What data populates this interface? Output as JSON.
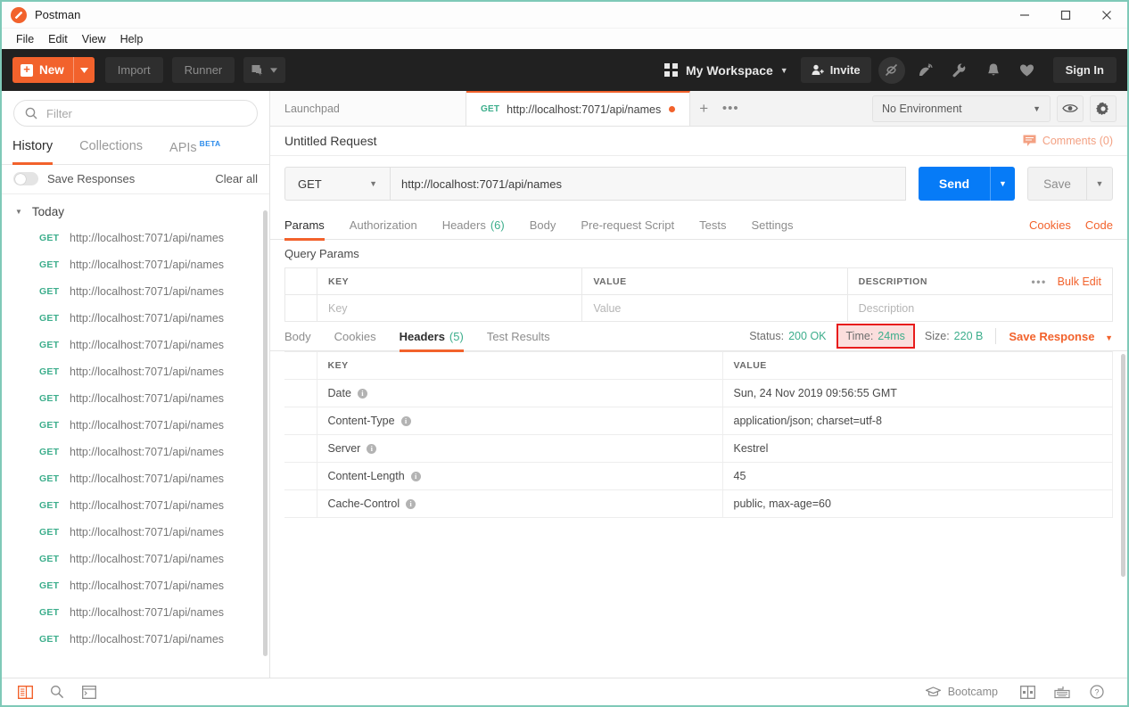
{
  "window": {
    "app_title": "Postman",
    "logo_icon": "postman-logo-icon",
    "minimize": "—",
    "maximize": "☐",
    "close": "✕"
  },
  "menubar": {
    "items": [
      "File",
      "Edit",
      "View",
      "Help"
    ]
  },
  "toolbar": {
    "new_label": "New",
    "new_plus": "+",
    "import_label": "Import",
    "runner_label": "Runner",
    "workspace_label": "My Workspace",
    "invite_label": "Invite",
    "sign_in_label": "Sign In",
    "icons": [
      "sync-off-icon",
      "satellite-dish-icon",
      "wrench-icon",
      "bell-icon",
      "heart-icon"
    ]
  },
  "sidebar": {
    "filter_placeholder": "Filter",
    "tabs": [
      {
        "label": "History",
        "active": true
      },
      {
        "label": "Collections",
        "active": false
      },
      {
        "label": "APIs",
        "badge": "BETA",
        "active": false
      }
    ],
    "save_responses_label": "Save Responses",
    "save_responses_on": false,
    "clear_all_label": "Clear all",
    "group_label": "Today",
    "history_items": [
      {
        "method": "GET",
        "url": "http://localhost:7071/api/names"
      },
      {
        "method": "GET",
        "url": "http://localhost:7071/api/names"
      },
      {
        "method": "GET",
        "url": "http://localhost:7071/api/names"
      },
      {
        "method": "GET",
        "url": "http://localhost:7071/api/names"
      },
      {
        "method": "GET",
        "url": "http://localhost:7071/api/names"
      },
      {
        "method": "GET",
        "url": "http://localhost:7071/api/names"
      },
      {
        "method": "GET",
        "url": "http://localhost:7071/api/names"
      },
      {
        "method": "GET",
        "url": "http://localhost:7071/api/names"
      },
      {
        "method": "GET",
        "url": "http://localhost:7071/api/names"
      },
      {
        "method": "GET",
        "url": "http://localhost:7071/api/names"
      },
      {
        "method": "GET",
        "url": "http://localhost:7071/api/names"
      },
      {
        "method": "GET",
        "url": "http://localhost:7071/api/names"
      },
      {
        "method": "GET",
        "url": "http://localhost:7071/api/names"
      },
      {
        "method": "GET",
        "url": "http://localhost:7071/api/names"
      },
      {
        "method": "GET",
        "url": "http://localhost:7071/api/names"
      },
      {
        "method": "GET",
        "url": "http://localhost:7071/api/names"
      }
    ]
  },
  "tabs_bar": {
    "launchpad_label": "Launchpad",
    "request_tab": {
      "method": "GET",
      "url": "http://localhost:7071/api/names",
      "unsaved": true
    },
    "new_tab_label": "+",
    "more_label": "•••",
    "environment_label": "No Environment",
    "eye_icon": "eye-icon",
    "gear_icon": "gear-icon"
  },
  "request": {
    "title": "Untitled Request",
    "comments_label": "Comments (0)",
    "method": "GET",
    "url": "http://localhost:7071/api/names",
    "send_label": "Send",
    "save_label": "Save",
    "tabs": [
      {
        "label": "Params",
        "count": null,
        "active": true
      },
      {
        "label": "Authorization",
        "count": null,
        "active": false
      },
      {
        "label": "Headers",
        "count": "(6)",
        "active": false
      },
      {
        "label": "Body",
        "count": null,
        "active": false
      },
      {
        "label": "Pre-request Script",
        "count": null,
        "active": false
      },
      {
        "label": "Tests",
        "count": null,
        "active": false
      },
      {
        "label": "Settings",
        "count": null,
        "active": false
      }
    ],
    "cookies_label": "Cookies",
    "code_label": "Code",
    "query_params_label": "Query Params",
    "params_table": {
      "headers": [
        "KEY",
        "VALUE",
        "DESCRIPTION"
      ],
      "bulk_edit_label": "Bulk Edit",
      "dots_label": "•••",
      "placeholder_row": [
        "Key",
        "Value",
        "Description"
      ]
    }
  },
  "response": {
    "tabs": [
      {
        "label": "Body",
        "count": null,
        "active": false
      },
      {
        "label": "Cookies",
        "count": null,
        "active": false
      },
      {
        "label": "Headers",
        "count": "(5)",
        "active": true
      },
      {
        "label": "Test Results",
        "count": null,
        "active": false
      }
    ],
    "status_label": "Status:",
    "status_value": "200 OK",
    "time_label": "Time:",
    "time_value": "24ms",
    "size_label": "Size:",
    "size_value": "220 B",
    "save_response_label": "Save Response",
    "headers_table": {
      "headers": [
        "KEY",
        "VALUE"
      ],
      "rows": [
        {
          "key": "Date",
          "value": "Sun, 24 Nov 2019 09:56:55 GMT"
        },
        {
          "key": "Content-Type",
          "value": "application/json; charset=utf-8"
        },
        {
          "key": "Server",
          "value": "Kestrel"
        },
        {
          "key": "Content-Length",
          "value": "45"
        },
        {
          "key": "Cache-Control",
          "value": "public, max-age=60"
        }
      ]
    }
  },
  "footer": {
    "left_icons": [
      "sidebar-toggle-icon",
      "search-icon",
      "console-icon"
    ],
    "bootcamp_label": "Bootcamp",
    "right_icons": [
      "two-pane-icon",
      "keyboard-icon",
      "help-icon"
    ]
  },
  "colors": {
    "accent": "#f2622c",
    "green": "#3dae8c",
    "blue": "#067bf7",
    "dark": "#212121",
    "highlight_border": "#e81c1c",
    "highlight_fill": "#fbdedd"
  }
}
